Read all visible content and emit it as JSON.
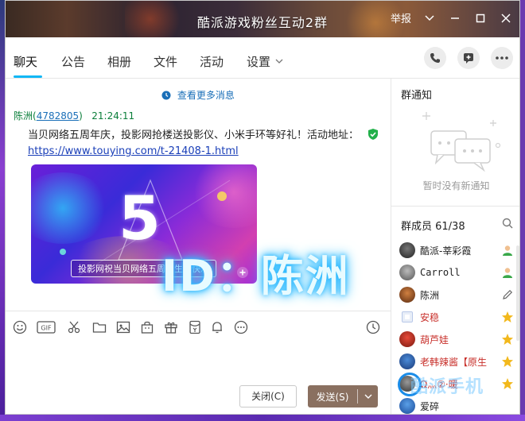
{
  "window": {
    "title": "酷派游戏粉丝互动2群",
    "report_label": "举报"
  },
  "tabs": [
    {
      "label": "聊天"
    },
    {
      "label": "公告"
    },
    {
      "label": "相册"
    },
    {
      "label": "文件"
    },
    {
      "label": "活动"
    },
    {
      "label": "设置"
    }
  ],
  "header_actions": [
    "phone-icon",
    "add-app-icon",
    "more-icon"
  ],
  "chat": {
    "more_messages": "查看更多消息",
    "message": {
      "sender_name": "陈洲",
      "sender_qq": "4782805",
      "time": "21:24:11",
      "text": "当贝网络五周年庆，投影网抢楼送投影仪、小米手环等好礼！活动地址：",
      "link": "https://www.touying.com/t-21408-1.html",
      "image": {
        "big_number": "5",
        "caption": "投影网祝当贝网络五周岁生日快乐"
      }
    },
    "overlay_watermark": "ID：陈洲"
  },
  "toolbar": {
    "items": [
      "emoji-icon",
      "gif-icon",
      "scissors-icon",
      "folder-icon",
      "image-icon",
      "gift-bag-icon",
      "gift-icon",
      "red-packet-icon",
      "bell-icon",
      "more-circle-icon",
      "history-icon"
    ],
    "gif_label": "GIF"
  },
  "input": {
    "close_label": "关闭(C)",
    "send_label": "发送(S)"
  },
  "sidebar": {
    "notice_title": "群通知",
    "notice_empty": "暂时没有新通知",
    "members_title": "群成员 61/38",
    "members": [
      {
        "name": "酷派-莘彩霞",
        "color": "#222222",
        "badge": "person-green-icon"
      },
      {
        "name": "Carroll",
        "color": "#222222",
        "badge": "person-green-icon"
      },
      {
        "name": "陈洲",
        "color": "#222222",
        "badge": "edit-icon"
      },
      {
        "name": "安稳",
        "color": "#c8302b",
        "badge": "star-gold-icon"
      },
      {
        "name": "葫芦娃",
        "color": "#c8302b",
        "badge": "star-gold-icon"
      },
      {
        "name": "老韩辣酱【原生",
        "color": "#c8302b",
        "badge": "star-gold-icon"
      },
      {
        "name": "Ω灬②·暖",
        "color": "#c8302b",
        "badge": "star-gold-icon"
      },
      {
        "name": "爱碎",
        "color": "#222222",
        "badge": ""
      }
    ],
    "brand_watermark": "酷派手机"
  }
}
